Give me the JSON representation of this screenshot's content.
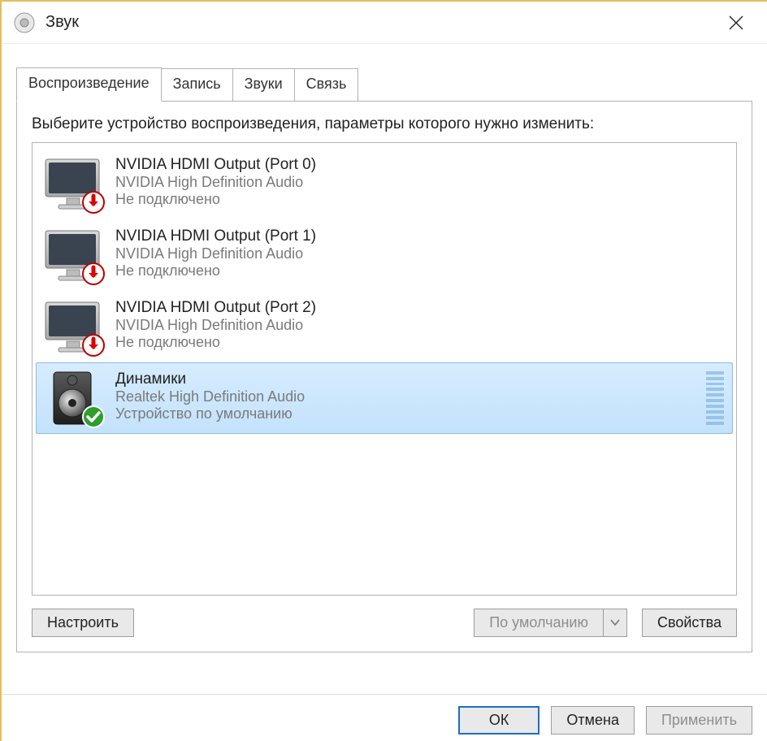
{
  "window": {
    "title": "Звук"
  },
  "tabs": [
    {
      "label": "Воспроизведение",
      "active": true
    },
    {
      "label": "Запись",
      "active": false
    },
    {
      "label": "Звуки",
      "active": false
    },
    {
      "label": "Связь",
      "active": false
    }
  ],
  "instructions": "Выберите устройство воспроизведения, параметры которого нужно изменить:",
  "devices": [
    {
      "name": "NVIDIA HDMI Output (Port 0)",
      "driver": "NVIDIA High Definition Audio",
      "status": "Не подключено",
      "icon": "monitor",
      "badge": "disconnected",
      "selected": false
    },
    {
      "name": "NVIDIA HDMI Output (Port 1)",
      "driver": "NVIDIA High Definition Audio",
      "status": "Не подключено",
      "icon": "monitor",
      "badge": "disconnected",
      "selected": false
    },
    {
      "name": "NVIDIA HDMI Output (Port 2)",
      "driver": "NVIDIA High Definition Audio",
      "status": "Не подключено",
      "icon": "monitor",
      "badge": "disconnected",
      "selected": false
    },
    {
      "name": "Динамики",
      "driver": "Realtek High Definition Audio",
      "status": "Устройство по умолчанию",
      "icon": "speaker",
      "badge": "default",
      "selected": true
    }
  ],
  "panelButtons": {
    "configure": "Настроить",
    "setDefault": "По умолчанию",
    "properties": "Свойства"
  },
  "dialogButtons": {
    "ok": "ОК",
    "cancel": "Отмена",
    "apply": "Применить"
  }
}
